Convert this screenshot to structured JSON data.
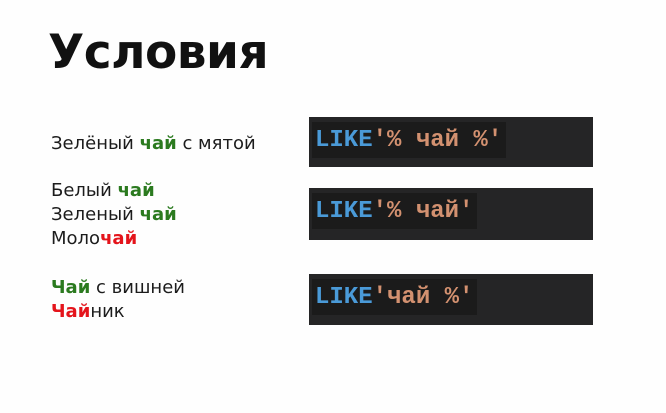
{
  "slide": {
    "title": "Условия"
  },
  "colors": {
    "match_green": "#2b7a1f",
    "match_red": "#e4141b",
    "code_keyword": "#4a9ad8",
    "code_string": "#d39170",
    "code_background": "#252526"
  },
  "examples": [
    {
      "lines": [
        {
          "before": "Зелёный ",
          "highlight": "чай",
          "highlight_color": "green",
          "after": " с мятой"
        }
      ],
      "code": {
        "keyword": "LIKE",
        "pattern": "'% чай %'"
      }
    },
    {
      "lines": [
        {
          "before": "Белый ",
          "highlight": "чай",
          "highlight_color": "green",
          "after": ""
        },
        {
          "before": "Зеленый ",
          "highlight": "чай",
          "highlight_color": "green",
          "after": ""
        },
        {
          "before": "Моло",
          "highlight": "чай",
          "highlight_color": "red",
          "after": ""
        }
      ],
      "code": {
        "keyword": "LIKE",
        "pattern": "'% чай'"
      }
    },
    {
      "lines": [
        {
          "before": "",
          "highlight": "Чай",
          "highlight_color": "green",
          "after": " с вишней"
        },
        {
          "before": "",
          "highlight": "Чай",
          "highlight_color": "red",
          "after": "ник"
        }
      ],
      "code": {
        "keyword": "LIKE",
        "pattern": "'чай %'"
      }
    }
  ]
}
